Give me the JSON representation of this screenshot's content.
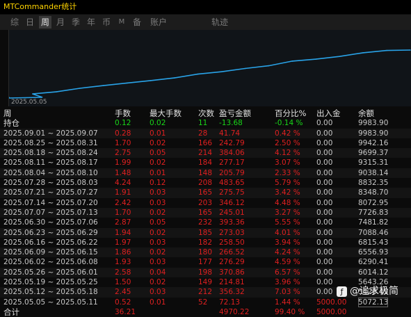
{
  "window": {
    "title": "MTCommander统计"
  },
  "tabs": [
    {
      "label": "综"
    },
    {
      "label": "日"
    },
    {
      "label": "周"
    },
    {
      "label": "月"
    },
    {
      "label": "季"
    },
    {
      "label": "年"
    },
    {
      "label": "币"
    },
    {
      "label": "M"
    },
    {
      "label": "备"
    },
    {
      "label": "账户"
    },
    {
      "label": "轨迹"
    }
  ],
  "active_tab": "周",
  "chart": {
    "start_date": "2025.05.05"
  },
  "chart_data": {
    "type": "line",
    "x": [
      "2025.05.05",
      "2025.05.12",
      "2025.05.19",
      "2025.05.26",
      "2025.06.02",
      "2025.06.09",
      "2025.06.16",
      "2025.06.23",
      "2025.06.30",
      "2025.07.07",
      "2025.07.14",
      "2025.07.21",
      "2025.07.28",
      "2025.08.04",
      "2025.08.11",
      "2025.08.18",
      "2025.08.25",
      "2025.09.01"
    ],
    "series": [
      {
        "values": [
          5072.13,
          5428.45,
          5643.26,
          6014.12,
          6290.41,
          6556.93,
          6815.43,
          7088.46,
          7481.82,
          7726.83,
          8072.95,
          8348.7,
          8832.35,
          9038.14,
          9315.31,
          9699.37,
          9942.16,
          9983.9
        ]
      }
    ],
    "color": "#29a3e8",
    "ylim": [
      5000,
      10200
    ]
  },
  "table": {
    "headers": [
      "周",
      "手数",
      "最大手数",
      "次数",
      "盈亏金额",
      "百分比%",
      "出入金",
      "余额"
    ],
    "open_row": {
      "label": "持仓",
      "lots": "0.12",
      "max_lots": "0.02",
      "count": "11",
      "pnl": "-13.68",
      "pct": "-0.14 %",
      "flow": "0.00",
      "balance": "9983.90"
    },
    "rows": [
      {
        "period": "2025.09.01 ~ 2025.09.07",
        "lots": "0.28",
        "max_lots": "0.01",
        "count": "28",
        "pnl": "41.74",
        "pct": "0.42 %",
        "flow": "0.00",
        "balance": "9983.90"
      },
      {
        "period": "2025.08.25 ~ 2025.08.31",
        "lots": "1.70",
        "max_lots": "0.02",
        "count": "166",
        "pnl": "242.79",
        "pct": "2.50 %",
        "flow": "0.00",
        "balance": "9942.16"
      },
      {
        "period": "2025.08.18 ~ 2025.08.24",
        "lots": "2.75",
        "max_lots": "0.05",
        "count": "214",
        "pnl": "384.06",
        "pct": "4.12 %",
        "flow": "0.00",
        "balance": "9699.37"
      },
      {
        "period": "2025.08.11 ~ 2025.08.17",
        "lots": "1.99",
        "max_lots": "0.02",
        "count": "184",
        "pnl": "277.17",
        "pct": "3.07 %",
        "flow": "0.00",
        "balance": "9315.31"
      },
      {
        "period": "2025.08.04 ~ 2025.08.10",
        "lots": "1.48",
        "max_lots": "0.01",
        "count": "148",
        "pnl": "205.79",
        "pct": "2.33 %",
        "flow": "0.00",
        "balance": "9038.14"
      },
      {
        "period": "2025.07.28 ~ 2025.08.03",
        "lots": "4.24",
        "max_lots": "0.12",
        "count": "208",
        "pnl": "483.65",
        "pct": "5.79 %",
        "flow": "0.00",
        "balance": "8832.35"
      },
      {
        "period": "2025.07.21 ~ 2025.07.27",
        "lots": "1.91",
        "max_lots": "0.03",
        "count": "165",
        "pnl": "275.75",
        "pct": "3.42 %",
        "flow": "0.00",
        "balance": "8348.70"
      },
      {
        "period": "2025.07.14 ~ 2025.07.20",
        "lots": "2.42",
        "max_lots": "0.03",
        "count": "203",
        "pnl": "346.12",
        "pct": "4.48 %",
        "flow": "0.00",
        "balance": "8072.95"
      },
      {
        "period": "2025.07.07 ~ 2025.07.13",
        "lots": "1.70",
        "max_lots": "0.02",
        "count": "165",
        "pnl": "245.01",
        "pct": "3.27 %",
        "flow": "0.00",
        "balance": "7726.83"
      },
      {
        "period": "2025.06.30 ~ 2025.07.06",
        "lots": "2.87",
        "max_lots": "0.05",
        "count": "232",
        "pnl": "393.36",
        "pct": "5.55 %",
        "flow": "0.00",
        "balance": "7481.82"
      },
      {
        "period": "2025.06.23 ~ 2025.06.29",
        "lots": "1.94",
        "max_lots": "0.02",
        "count": "185",
        "pnl": "273.03",
        "pct": "4.01 %",
        "flow": "0.00",
        "balance": "7088.46"
      },
      {
        "period": "2025.06.16 ~ 2025.06.22",
        "lots": "1.97",
        "max_lots": "0.03",
        "count": "182",
        "pnl": "258.50",
        "pct": "3.94 %",
        "flow": "0.00",
        "balance": "6815.43"
      },
      {
        "period": "2025.06.09 ~ 2025.06.15",
        "lots": "1.86",
        "max_lots": "0.02",
        "count": "180",
        "pnl": "266.52",
        "pct": "4.24 %",
        "flow": "0.00",
        "balance": "6556.93"
      },
      {
        "period": "2025.06.02 ~ 2025.06.08",
        "lots": "1.93",
        "max_lots": "0.03",
        "count": "177",
        "pnl": "276.29",
        "pct": "4.59 %",
        "flow": "0.00",
        "balance": "6290.41"
      },
      {
        "period": "2025.05.26 ~ 2025.06.01",
        "lots": "2.58",
        "max_lots": "0.04",
        "count": "198",
        "pnl": "370.86",
        "pct": "6.57 %",
        "flow": "0.00",
        "balance": "6014.12"
      },
      {
        "period": "2025.05.19 ~ 2025.05.25",
        "lots": "1.50",
        "max_lots": "0.02",
        "count": "149",
        "pnl": "214.81",
        "pct": "3.96 %",
        "flow": "0.00",
        "balance": "5643.26"
      },
      {
        "period": "2025.05.12 ~ 2025.05.18",
        "lots": "2.45",
        "max_lots": "0.03",
        "count": "212",
        "pnl": "356.32",
        "pct": "7.03 %",
        "flow": "0.00",
        "balance": "5428.45"
      },
      {
        "period": "2025.05.05 ~ 2025.05.11",
        "lots": "0.52",
        "max_lots": "0.01",
        "count": "52",
        "pnl": "72.13",
        "pct": "1.44 %",
        "flow": "5000.00",
        "balance": "5072.13"
      }
    ],
    "total_row": {
      "label": "合计",
      "lots": "36.21",
      "pnl": "4970.22",
      "pct": "99.40 %",
      "flow": "5000.00"
    }
  },
  "watermark": {
    "text": "@追求极简",
    "icon": "app-logo-icon"
  },
  "colors": {
    "title": "#ffd400",
    "loss_red": "#e02020",
    "profit_green": "#19d619",
    "line": "#29a3e8"
  }
}
